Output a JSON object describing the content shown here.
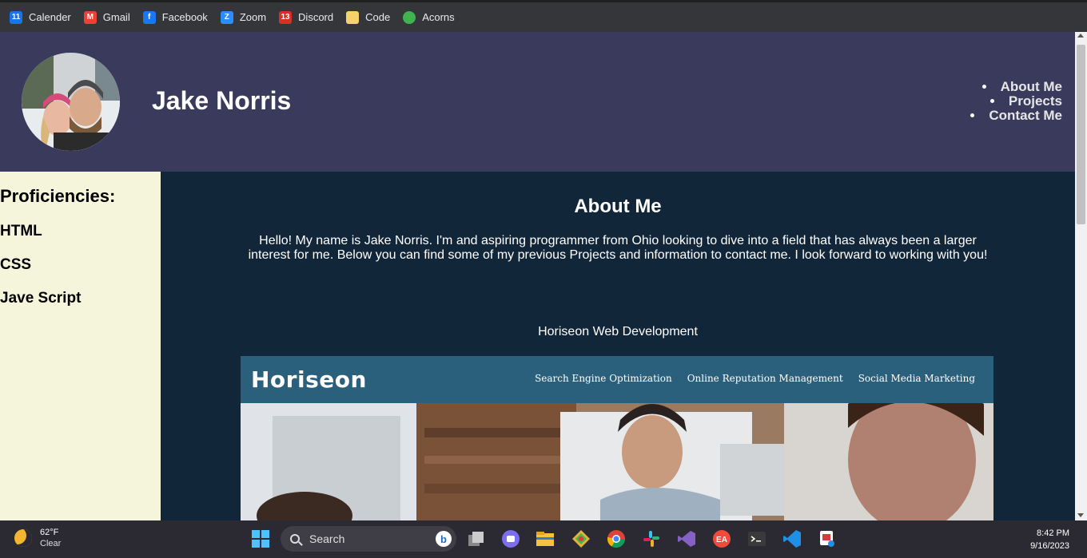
{
  "bookmarks": [
    {
      "label": "Calender",
      "icon": "calendar-icon",
      "color": "#1a73e8",
      "glyph": "11"
    },
    {
      "label": "Gmail",
      "icon": "gmail-icon",
      "color": "#ea4335",
      "glyph": "M"
    },
    {
      "label": "Facebook",
      "icon": "facebook-icon",
      "color": "#1877f2",
      "glyph": "f"
    },
    {
      "label": "Zoom",
      "icon": "zoom-icon",
      "color": "#2d8cff",
      "glyph": "Z"
    },
    {
      "label": "Discord",
      "icon": "discord-icon",
      "color": "#d93025",
      "glyph": "13"
    },
    {
      "label": "Code",
      "icon": "folder-icon",
      "color": "#f6d26b",
      "glyph": ""
    },
    {
      "label": "Acorns",
      "icon": "acorns-icon",
      "color": "#3fb34f",
      "glyph": ""
    }
  ],
  "header": {
    "name": "Jake Norris",
    "nav": [
      "About Me",
      "Projects",
      "Contact Me"
    ]
  },
  "sidebar": {
    "title": "Proficiencies:",
    "items": [
      "HTML",
      "CSS",
      "Jave Script"
    ]
  },
  "main": {
    "about_title": "About Me",
    "about_text": "Hello! My name is Jake Norris. I'm and aspiring programmer from Ohio looking to dive into a field that has always been a larger interest for me. Below you can find some of my previous Projects and information to contact me. I look forward to working with you!",
    "project_title": "Horiseon Web Development",
    "project_screenshot": {
      "logo": "Horiseon",
      "nav": [
        "Search Engine Optimization",
        "Online Reputation Management",
        "Social Media Marketing"
      ]
    }
  },
  "taskbar": {
    "weather_temp": "62°F",
    "weather_desc": "Clear",
    "search_placeholder": "Search",
    "time": "8:42 PM",
    "date": "9/16/2023"
  },
  "colors": {
    "header_bg": "#3a3a5c",
    "main_bg": "#12263a",
    "sidebar_bg": "#f5f5dc"
  }
}
